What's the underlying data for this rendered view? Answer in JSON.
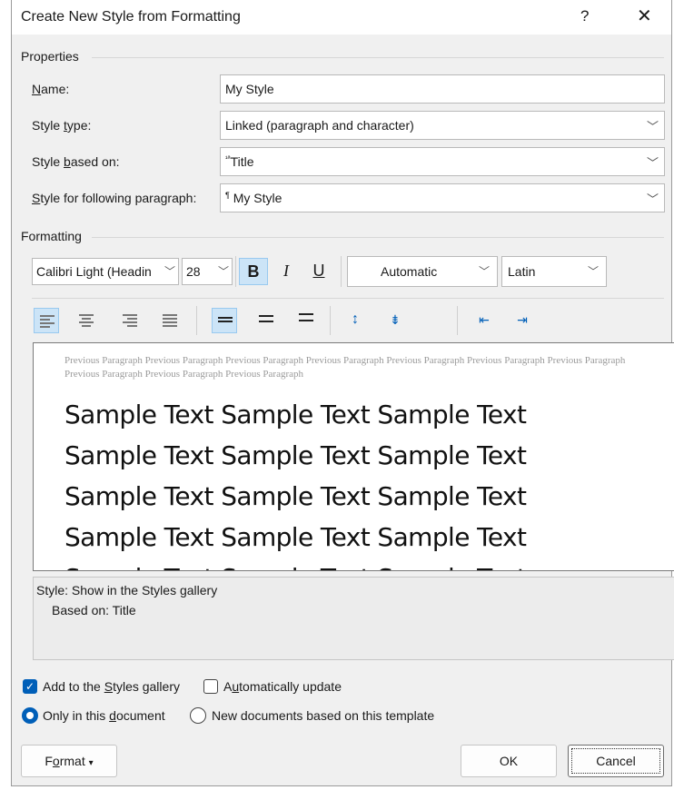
{
  "dialog": {
    "title": "Create New Style from Formatting",
    "help": "?",
    "close": "✕"
  },
  "properties": {
    "group_label": "Properties",
    "name_label_pre": "",
    "name_label_ul": "N",
    "name_label_post": "ame:",
    "name_value": "My Style",
    "type_label_pre": "Style ",
    "type_label_ul": "t",
    "type_label_post": "ype:",
    "type_value": "Linked (paragraph and character)",
    "based_label_pre": "Style ",
    "based_label_ul": "b",
    "based_label_post": "ased on:",
    "based_icon": "¹ª",
    "based_value": "Title",
    "following_label_pre": "",
    "following_label_ul": "S",
    "following_label_post": "tyle for following paragraph:",
    "following_icon": "¶",
    "following_value": "My Style"
  },
  "formatting": {
    "group_label": "Formatting",
    "font": "Calibri Light (Headin",
    "size": "28",
    "bold": "B",
    "italic": "I",
    "underline": "U",
    "color": "Automatic",
    "script": "Latin"
  },
  "preview": {
    "previous_paragraph": "Previous Paragraph Previous Paragraph Previous Paragraph Previous Paragraph Previous Paragraph Previous Paragraph Previous Paragraph Previous Paragraph Previous Paragraph Previous Paragraph",
    "sample_lines": [
      "Sample Text Sample Text Sample Text",
      "Sample Text Sample Text Sample Text",
      "Sample Text Sample Text Sample Text",
      "Sample Text Sample Text Sample Text",
      "Sample Text Sample Text Sample Text"
    ]
  },
  "description": {
    "line1": "Style: Show in the Styles gallery",
    "line2": "Based on: Title"
  },
  "options": {
    "add_gallery_pre": "Add to the ",
    "add_gallery_ul": "S",
    "add_gallery_post": "tyles gallery",
    "auto_update_pre": "A",
    "auto_update_ul": "u",
    "auto_update_post": "tomatically update",
    "only_doc_pre": "Only in this ",
    "only_doc_ul": "d",
    "only_doc_post": "ocument",
    "new_docs": "New documents based on this template"
  },
  "buttons": {
    "format_pre": "F",
    "format_ul": "o",
    "format_post": "rmat",
    "format_arrow": "▾",
    "ok": "OK",
    "cancel": "Cancel"
  },
  "colors": {
    "accent": "#005fb8",
    "selected_tool": "#cce4f7"
  }
}
